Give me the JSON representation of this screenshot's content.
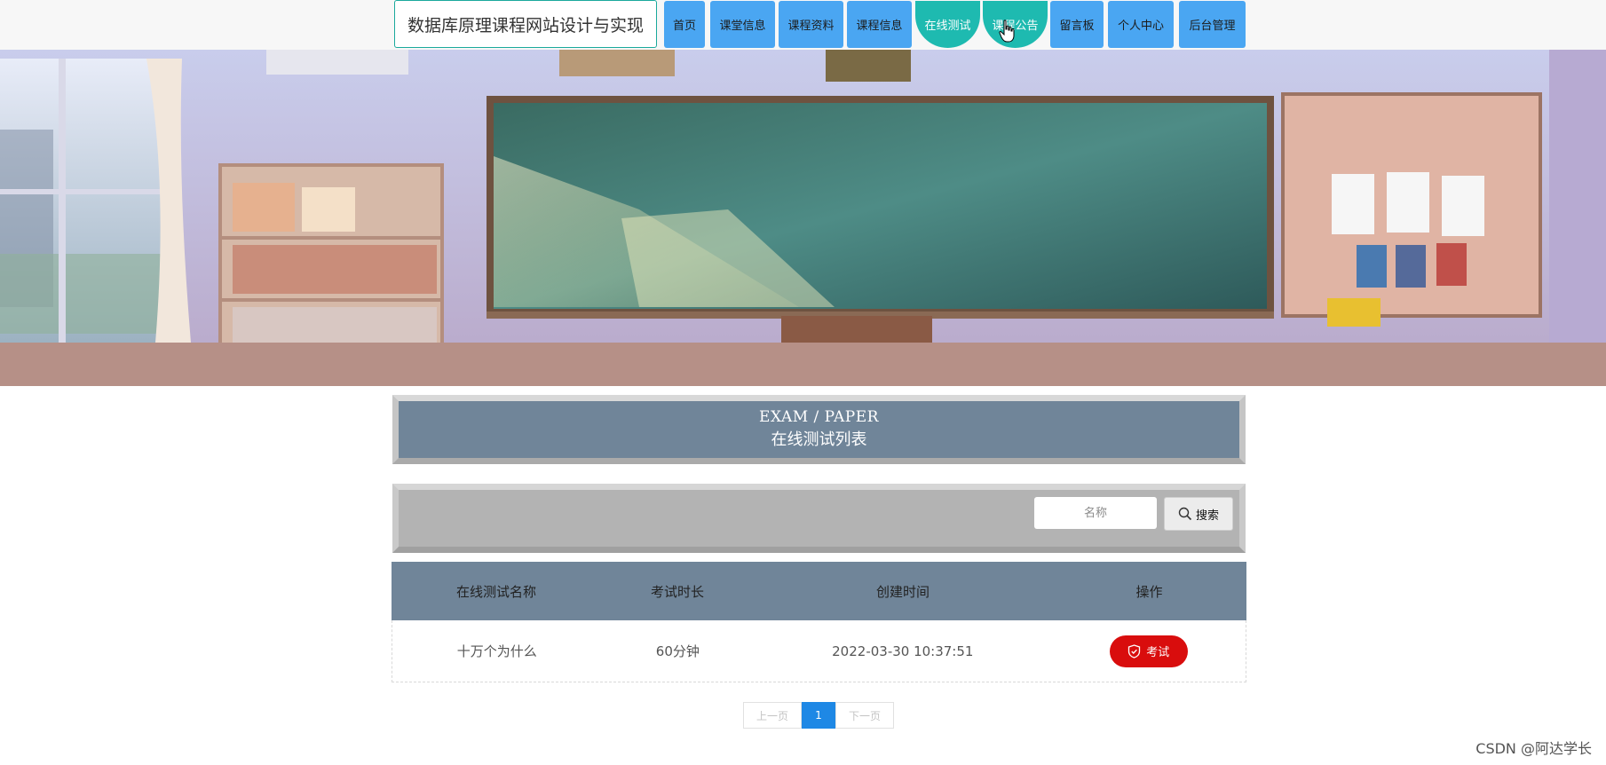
{
  "site_title": "数据库原理课程网站设计与实现",
  "nav": {
    "items": [
      {
        "label": "首页"
      },
      {
        "label": "课堂信息"
      },
      {
        "label": "课程资料"
      },
      {
        "label": "课程信息"
      },
      {
        "label": "在线测试"
      },
      {
        "label": "课程公告"
      },
      {
        "label": "留言板"
      },
      {
        "label": "个人中心"
      },
      {
        "label": "后台管理"
      }
    ],
    "active": "在线测试",
    "hover": "课程公告"
  },
  "section": {
    "title_en": "EXAM / PAPER",
    "title_cn": "在线测试列表"
  },
  "search": {
    "placeholder": "名称",
    "button_label": "搜索"
  },
  "table": {
    "headers": [
      "在线测试名称",
      "考试时长",
      "创建时间",
      "操作"
    ],
    "rows": [
      {
        "name": "十万个为什么",
        "duration": "60分钟",
        "created": "2022-03-30 10:37:51",
        "action": "考试"
      }
    ]
  },
  "pagination": {
    "prev": "上一页",
    "current": "1",
    "next": "下一页"
  },
  "watermark": "CSDN @阿达学长",
  "colors": {
    "nav_button": "#4aa6f2",
    "nav_active": "#1ebab0",
    "section_header": "#708599",
    "search_bar": "#b3b3b3",
    "exam_button": "#d90d0d",
    "page_current": "#1e88e5"
  }
}
